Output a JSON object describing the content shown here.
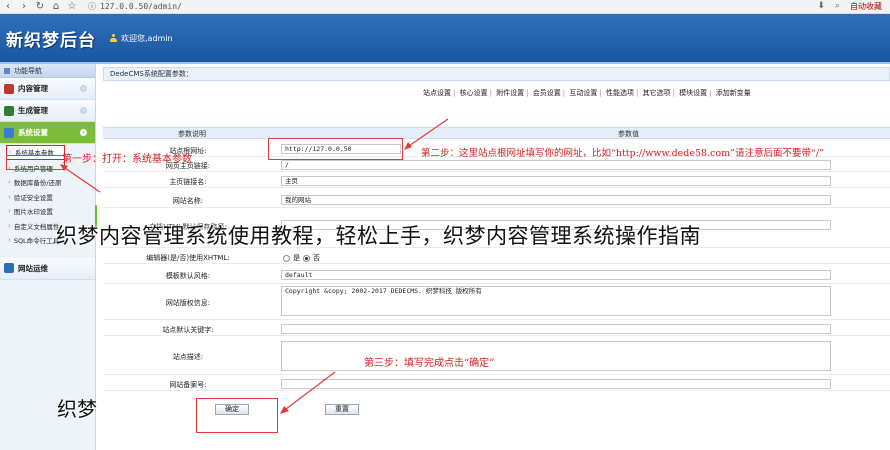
{
  "browser": {
    "back": "‹",
    "forward": "›",
    "reload": "↻",
    "home": "⌂",
    "star": "☆",
    "url": "127.0.0.50/admin/",
    "bookmark": "自动收藏"
  },
  "header": {
    "logo": "新织梦后台",
    "welcome": "欢迎您,admin"
  },
  "sidebar": {
    "title": "功能导航",
    "groups": [
      {
        "label": "内容管理",
        "color": "#c0392b"
      },
      {
        "label": "生成管理",
        "color": "#2e7d32"
      },
      {
        "label": "系统设置",
        "color": "#7dbb3c"
      }
    ],
    "items": [
      "系统基本参数",
      "系统用户管理",
      "数据库备份/还原",
      "验证安全设置",
      "图片水印设置",
      "自定义文档属性",
      "SQL命令行工具"
    ],
    "bottom_group": "网站运维"
  },
  "main": {
    "title": "DedeCMS系统配置参数：",
    "tabs": [
      "站点设置",
      "核心设置",
      "附件设置",
      "会员设置",
      "互动设置",
      "性能选项",
      "其它选项",
      "模块设置",
      "添加新变量"
    ],
    "col_param": "参数说明",
    "col_value": "参数值",
    "rows": [
      {
        "label": "站点根网址:",
        "value": "http://127.0.0.50"
      },
      {
        "label": "网页主页链接:",
        "value": "/"
      },
      {
        "label": "主页链接名:",
        "value": "主页"
      },
      {
        "label": "网站名称:",
        "value": "我的网站"
      },
      {
        "label": "文档HTML默认保存路径:",
        "value": ""
      },
      {
        "label": "编辑器(是/否)使用XHTML:",
        "option_yes": "是",
        "option_no": "否",
        "selected": "否"
      },
      {
        "label": "模板默认风格:",
        "value": "default"
      },
      {
        "label": "网站版权信息:",
        "value": "Copyright &copy; 2002-2017 DEDECMS. 织梦科技 版权所有"
      },
      {
        "label": "站点默认关键字:",
        "value": ""
      },
      {
        "label": "站点描述:",
        "value": ""
      },
      {
        "label": "网站备案号:",
        "value": ""
      }
    ],
    "ok_button": "确定",
    "reset_button": "重置"
  },
  "annotations": {
    "step1": "第一步：打开：系统基本参数",
    "step2": "第二步：这里站点根网址填写你的网址，比如“http://www.dede58.com”请注意后面不要带“/”",
    "step3": "第三步：填写完成点击“确定”"
  },
  "overlay": {
    "line1": "织梦内容管理系统使用教程，轻松上手，织梦内容管理系统操作指南",
    "line2": "织梦"
  },
  "colors": {
    "header": "#1a57a3",
    "active_group": "#7dbb3c",
    "annotation": "#d42020"
  }
}
